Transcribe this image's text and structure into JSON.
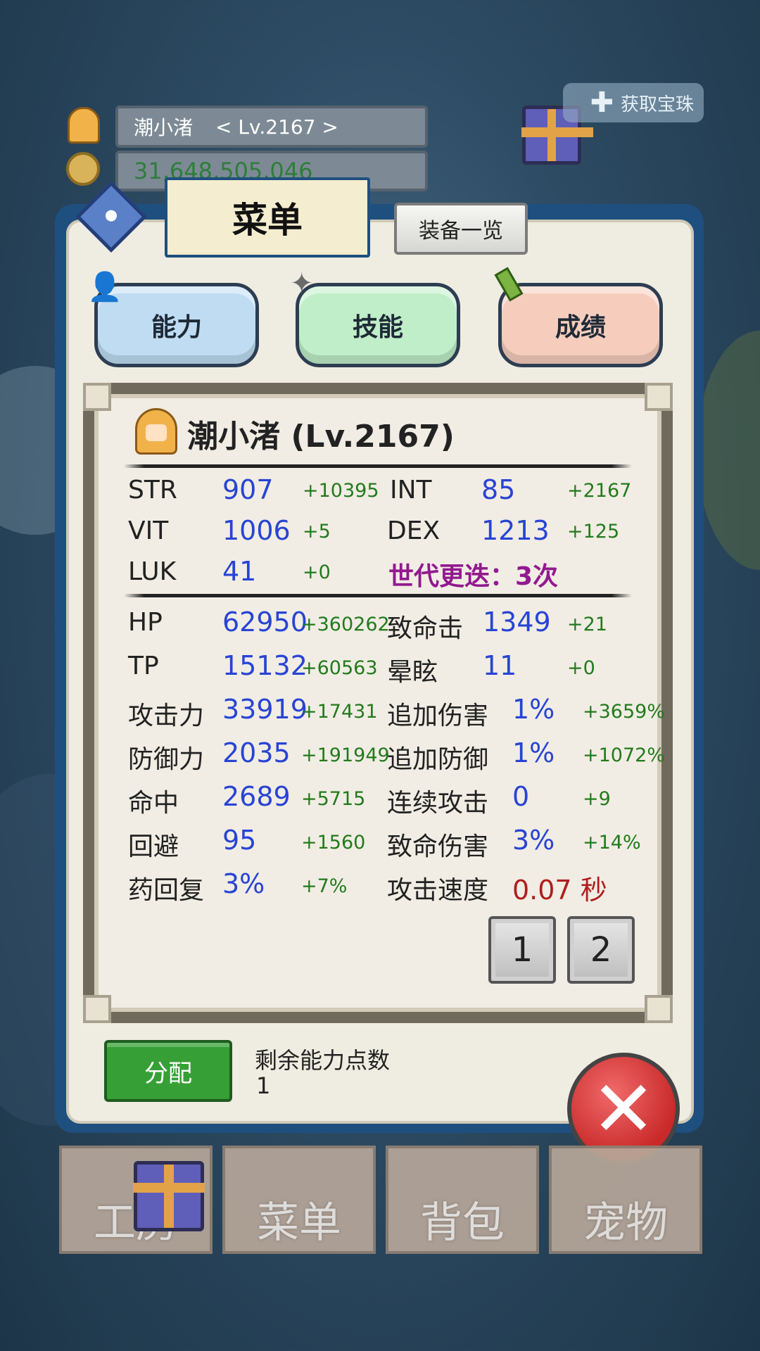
{
  "hud": {
    "player_name": "潮小渚",
    "player_level": "< Lv.2167 >",
    "gold": "31,648,505,046",
    "treasure_label": "获取宝珠"
  },
  "dialog": {
    "menu_tab": "菜单",
    "equip_list_button": "装备一览",
    "categories": [
      "能力",
      "技能",
      "成绩"
    ]
  },
  "character": {
    "title": "潮小渚 (Lv.2167)"
  },
  "base_stats": {
    "str_label": "STR",
    "str_value": "907",
    "str_bonus": "+10395",
    "int_label": "INT",
    "int_value": "85",
    "int_bonus": "+2167",
    "vit_label": "VIT",
    "vit_value": "1006",
    "vit_bonus": "+5",
    "dex_label": "DEX",
    "dex_value": "1213",
    "dex_bonus": "+125",
    "luk_label": "LUK",
    "luk_value": "41",
    "luk_bonus": "+0",
    "generation_text": "世代更迭：3次"
  },
  "combat_stats": {
    "left": [
      {
        "label": "HP",
        "value": "62950",
        "bonus": "+360262"
      },
      {
        "label": "TP",
        "value": "15132",
        "bonus": "+60563"
      },
      {
        "label": "攻击力",
        "value": "33919",
        "bonus": "+17431"
      },
      {
        "label": "防御力",
        "value": "2035",
        "bonus": "+191949"
      },
      {
        "label": "命中",
        "value": "2689",
        "bonus": "+5715"
      },
      {
        "label": "回避",
        "value": "95",
        "bonus": "+1560"
      },
      {
        "label": "药回复",
        "value": "3%",
        "bonus": "+7%"
      }
    ],
    "right": [
      {
        "label": "致命击",
        "value": "1349",
        "bonus": "+21"
      },
      {
        "label": "晕眩",
        "value": "11",
        "bonus": "+0"
      },
      {
        "label": "追加伤害",
        "value": "1%",
        "bonus": "+3659%"
      },
      {
        "label": "追加防御",
        "value": "1%",
        "bonus": "+1072%"
      },
      {
        "label": "连续攻击",
        "value": "0",
        "bonus": "+9"
      },
      {
        "label": "致命伤害",
        "value": "3%",
        "bonus": "+14%"
      },
      {
        "label": "攻击速度",
        "value": "0.07 秒",
        "bonus": ""
      }
    ]
  },
  "pages": [
    "1",
    "2"
  ],
  "points": {
    "assign_button": "分配",
    "remaining_label": "剩余能力点数",
    "remaining_value": "1"
  },
  "close_button": "✕",
  "bottom_nav": [
    "工房",
    "菜单",
    "背包",
    "宠物"
  ],
  "colors": {
    "stat_value": "#2844d4",
    "stat_bonus": "#237a1c",
    "generation_text": "#92198f",
    "attack_speed": "#b01d1d",
    "dialog_border": "#1f4f7e"
  }
}
